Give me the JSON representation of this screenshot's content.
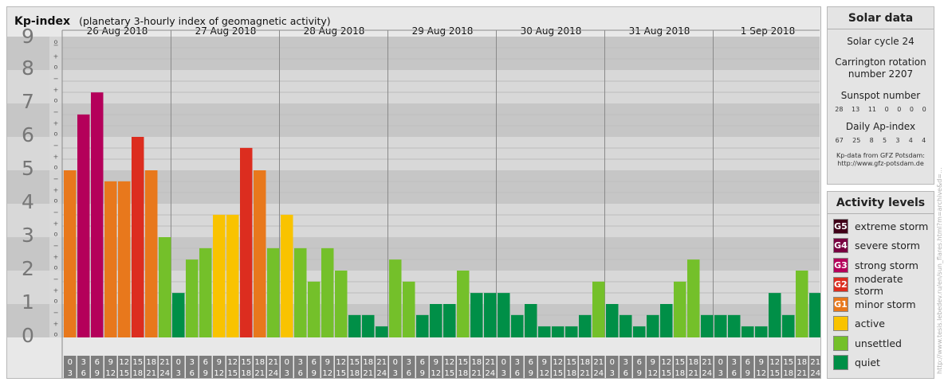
{
  "header": {
    "title": "Kp-index",
    "subtitle": "(planetary 3-hourly index of geomagnetic activity)"
  },
  "chart_data": {
    "type": "bar",
    "ylim": [
      0,
      9
    ],
    "y_ticks": [
      "0",
      "1",
      "2",
      "3",
      "4",
      "5",
      "6",
      "7",
      "8",
      "9"
    ],
    "minor_tick_symbols": [
      "+",
      "o",
      "−"
    ],
    "days": [
      "26 Aug 2018",
      "27 Aug 2018",
      "28 Aug 2018",
      "29 Aug 2018",
      "30 Aug 2018",
      "31 Aug 2018",
      "1 Sep 2018"
    ],
    "intervals_top": [
      "0",
      "3",
      "6",
      "9",
      "12",
      "15",
      "18",
      "21"
    ],
    "intervals_bottom": [
      "3",
      "6",
      "9",
      "12",
      "15",
      "18",
      "21",
      "24"
    ],
    "values": [
      [
        5.0,
        6.67,
        7.33,
        4.67,
        4.67,
        6.0,
        5.0,
        3.0
      ],
      [
        1.33,
        2.33,
        2.67,
        3.67,
        3.67,
        5.67,
        5.0,
        2.67
      ],
      [
        3.67,
        2.67,
        1.67,
        2.67,
        2.0,
        0.67,
        0.67,
        0.33
      ],
      [
        2.33,
        1.67,
        0.67,
        1.0,
        1.0,
        2.0,
        1.33,
        1.33
      ],
      [
        1.33,
        0.67,
        1.0,
        0.33,
        0.33,
        0.33,
        0.67,
        1.67
      ],
      [
        1.0,
        0.67,
        0.33,
        0.67,
        1.0,
        1.67,
        2.33,
        0.67
      ],
      [
        0.67,
        0.67,
        0.33,
        0.33,
        1.33,
        0.67,
        2.0,
        1.33
      ]
    ],
    "colors": {
      "quiet": "#008f47",
      "unsettled": "#74c02a",
      "active": "#f9c300",
      "minor_storm": "#e8781c",
      "moderate_storm": "#dc2d1f",
      "strong_storm": "#b4005a",
      "severe_storm": "#780040",
      "extreme_storm": "#400018"
    }
  },
  "solar": {
    "title": "Solar data",
    "cycle": "Solar cycle 24",
    "carrington_line1": "Carrington rotation",
    "carrington_line2": "number 2207",
    "sunspot_label": "Sunspot number",
    "sunspot_values": [
      "28",
      "13",
      "11",
      "0",
      "0",
      "0",
      "0"
    ],
    "ap_label": "Daily Ap-index",
    "ap_values": [
      "67",
      "25",
      "8",
      "5",
      "3",
      "4",
      "4"
    ],
    "source_line1": "Kp-data from GFZ Potsdam:",
    "source_line2": "http://www.gfz-potsdam.de"
  },
  "activity": {
    "title": "Activity levels",
    "levels": [
      {
        "badge": "G5",
        "label": "extreme storm",
        "color": "#400018"
      },
      {
        "badge": "G4",
        "label": "severe storm",
        "color": "#780040"
      },
      {
        "badge": "G3",
        "label": "strong storm",
        "color": "#b4005a"
      },
      {
        "badge": "G2",
        "label": "moderate storm",
        "color": "#dc2d1f"
      },
      {
        "badge": "G1",
        "label": "minor storm",
        "color": "#e8781c"
      },
      {
        "badge": "",
        "label": "active",
        "color": "#f9c300"
      },
      {
        "badge": "",
        "label": "unsettled",
        "color": "#74c02a"
      },
      {
        "badge": "",
        "label": "quiet",
        "color": "#008f47"
      }
    ]
  },
  "watermark": "http://www.tesis.lebedev.ru/en/sun_flares.html?m=archive&d=..."
}
